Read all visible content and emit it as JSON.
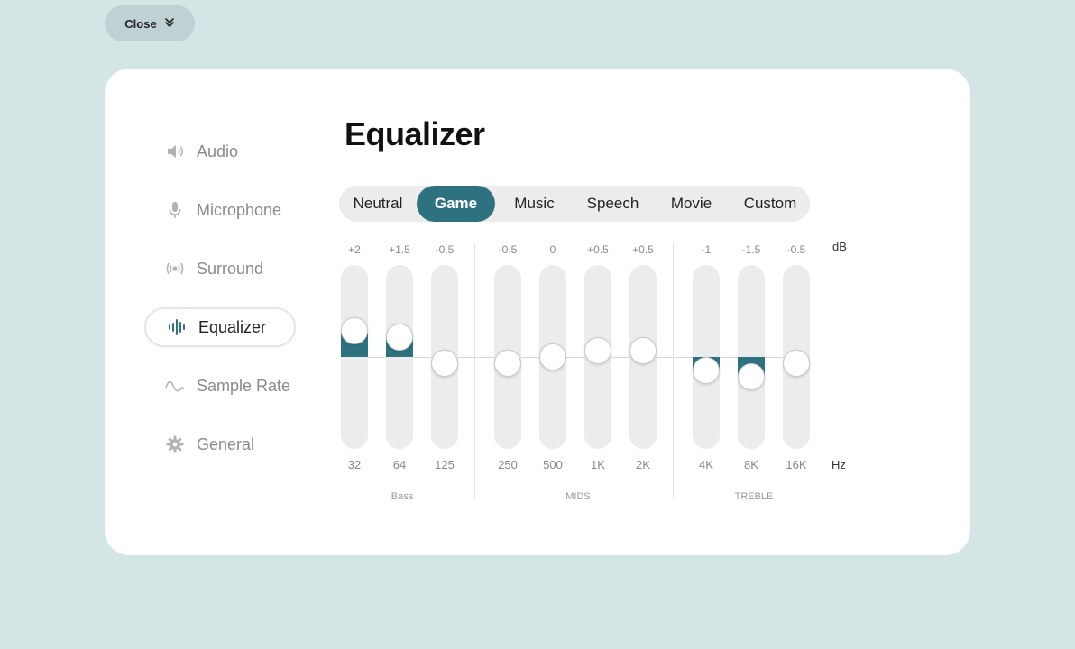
{
  "close_button": {
    "label": "Close",
    "icon": "chevron-double-down-icon"
  },
  "sidebar": {
    "items": [
      {
        "label": "Audio",
        "icon": "speaker-icon",
        "active": false
      },
      {
        "label": "Microphone",
        "icon": "microphone-icon",
        "active": false
      },
      {
        "label": "Surround",
        "icon": "surround-icon",
        "active": false
      },
      {
        "label": "Equalizer",
        "icon": "equalizer-icon",
        "active": true
      },
      {
        "label": "Sample Rate",
        "icon": "sine-wave-icon",
        "active": false
      },
      {
        "label": "General",
        "icon": "gear-icon",
        "active": false
      }
    ]
  },
  "page_title": "Equalizer",
  "presets": {
    "items": [
      "Neutral",
      "Game",
      "Music",
      "Speech",
      "Movie",
      "Custom"
    ],
    "selected": "Game"
  },
  "equalizer": {
    "db_unit": "dB",
    "hz_unit": "Hz",
    "bands": [
      {
        "freq": "32",
        "db_label": "+2",
        "db": 2
      },
      {
        "freq": "64",
        "db_label": "+1.5",
        "db": 1.5
      },
      {
        "freq": "125",
        "db_label": "-0.5",
        "db": -0.5
      },
      {
        "freq": "250",
        "db_label": "-0.5",
        "db": -0.5
      },
      {
        "freq": "500",
        "db_label": "0",
        "db": 0
      },
      {
        "freq": "1K",
        "db_label": "+0.5",
        "db": 0.5
      },
      {
        "freq": "2K",
        "db_label": "+0.5",
        "db": 0.5
      },
      {
        "freq": "4K",
        "db_label": "-1",
        "db": -1
      },
      {
        "freq": "8K",
        "db_label": "-1.5",
        "db": -1.5
      },
      {
        "freq": "16K",
        "db_label": "-0.5",
        "db": -0.5
      }
    ],
    "groups": [
      "Bass",
      "MIDS",
      "TREBLE"
    ],
    "accent_color": "#2e7280"
  }
}
